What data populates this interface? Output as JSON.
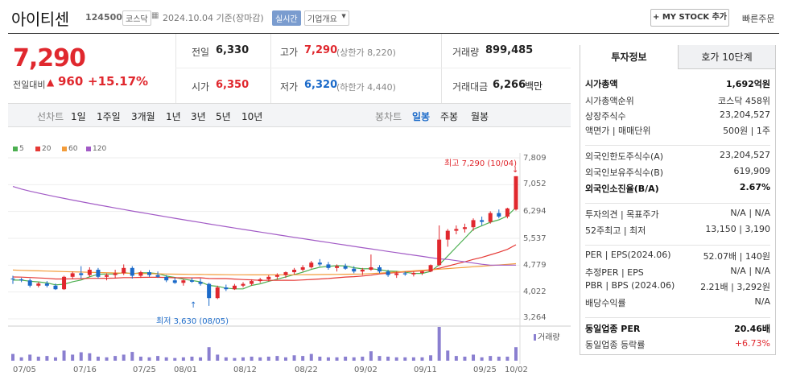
{
  "header": {
    "title": "아이티센",
    "code": "124500",
    "market_tag": "코스닥",
    "date_text": "2024.10.04 기준(장마감)",
    "live_tag": "실시간",
    "overview_tag": "기업개요",
    "mystock_label": "+ MY STOCK 추가",
    "quick_order": "빠른주문"
  },
  "quote": {
    "price": "7,290",
    "change_label": "전일대비",
    "change_value": "960",
    "change_pct": "+15.17%",
    "prev_label": "전일",
    "prev_value": "6,330",
    "high_label": "고가",
    "high_value": "7,290",
    "high_limit": "(상한가 8,220)",
    "volume_label": "거래량",
    "volume_value": "899,485",
    "open_label": "시가",
    "open_value": "6,350",
    "low_label": "저가",
    "low_value": "6,320",
    "low_limit": "(하한가 4,440)",
    "amount_label": "거래대금",
    "amount_value": "6,266",
    "amount_unit": "백만"
  },
  "periods": {
    "label": "선차트",
    "items": [
      "1일",
      "1주일",
      "3개월",
      "1년",
      "3년",
      "5년",
      "10년"
    ]
  },
  "candle_types": {
    "label": "봉차트",
    "items": [
      "일봉",
      "주봉",
      "월봉"
    ],
    "active": "일봉"
  },
  "chart_data": {
    "type": "candlestick",
    "legend": [
      {
        "name": "5",
        "color": "#4caf50"
      },
      {
        "name": "20",
        "color": "#e53935"
      },
      {
        "name": "60",
        "color": "#f39c3a"
      },
      {
        "name": "120",
        "color": "#a25bc6"
      }
    ],
    "yticks": [
      "7,809",
      "7,052",
      "6,294",
      "5,537",
      "4,779",
      "4,022",
      "3,264"
    ],
    "xticks": [
      "07/05",
      "07/16",
      "07/25",
      "08/01",
      "08/12",
      "08/22",
      "09/02",
      "09/11",
      "09/25",
      "10/02"
    ],
    "high_annotation": "최고 7,290 (10/04)",
    "low_annotation": "최저 3,630 (08/05)",
    "volume_label": "거래량",
    "candles": [
      [
        4400,
        4480,
        4250,
        4380
      ],
      [
        4380,
        4420,
        4300,
        4350
      ],
      [
        4350,
        4400,
        4150,
        4200
      ],
      [
        4200,
        4300,
        4150,
        4260
      ],
      [
        4260,
        4330,
        4150,
        4200
      ],
      [
        4200,
        4260,
        4080,
        4100
      ],
      [
        4100,
        4480,
        4080,
        4450
      ],
      [
        4450,
        4600,
        4380,
        4550
      ],
      [
        4550,
        4750,
        4400,
        4500
      ],
      [
        4500,
        4720,
        4450,
        4650
      ],
      [
        4650,
        4700,
        4400,
        4450
      ],
      [
        4450,
        4550,
        4350,
        4500
      ],
      [
        4500,
        4650,
        4400,
        4550
      ],
      [
        4550,
        4800,
        4500,
        4700
      ],
      [
        4700,
        4750,
        4400,
        4480
      ],
      [
        4480,
        4620,
        4420,
        4580
      ],
      [
        4580,
        4640,
        4450,
        4500
      ],
      [
        4500,
        4600,
        4420,
        4450
      ],
      [
        4450,
        4500,
        4300,
        4350
      ],
      [
        4350,
        4420,
        4250,
        4280
      ],
      [
        4280,
        4380,
        4200,
        4350
      ],
      [
        4350,
        4420,
        4280,
        4310
      ],
      [
        4310,
        4400,
        4200,
        4250
      ],
      [
        4250,
        4280,
        3630,
        3850
      ],
      [
        3850,
        4200,
        3820,
        4150
      ],
      [
        4150,
        4230,
        4050,
        4100
      ],
      [
        4100,
        4250,
        4080,
        4200
      ],
      [
        4200,
        4300,
        4150,
        4250
      ],
      [
        4250,
        4380,
        4200,
        4330
      ],
      [
        4330,
        4420,
        4280,
        4380
      ],
      [
        4380,
        4500,
        4320,
        4450
      ],
      [
        4450,
        4550,
        4380,
        4500
      ],
      [
        4500,
        4600,
        4420,
        4580
      ],
      [
        4580,
        4700,
        4520,
        4650
      ],
      [
        4650,
        4780,
        4600,
        4720
      ],
      [
        4720,
        4900,
        4680,
        4850
      ],
      [
        4850,
        4950,
        4750,
        4800
      ],
      [
        4800,
        4870,
        4650,
        4700
      ],
      [
        4700,
        4800,
        4600,
        4750
      ],
      [
        4750,
        4820,
        4650,
        4680
      ],
      [
        4680,
        4750,
        4550,
        4600
      ],
      [
        4600,
        4700,
        4500,
        4650
      ],
      [
        4650,
        5080,
        4620,
        4720
      ],
      [
        4720,
        4780,
        4550,
        4600
      ],
      [
        4600,
        4650,
        4450,
        4500
      ],
      [
        4500,
        4600,
        4420,
        4550
      ],
      [
        4550,
        4600,
        4480,
        4520
      ],
      [
        4520,
        4600,
        4460,
        4560
      ],
      [
        4560,
        4620,
        4500,
        4600
      ],
      [
        4600,
        4800,
        4580,
        4780
      ],
      [
        4780,
        5900,
        4750,
        5500
      ],
      [
        5500,
        5800,
        5300,
        5750
      ],
      [
        5750,
        5900,
        5650,
        5800
      ],
      [
        5800,
        5950,
        5700,
        5850
      ],
      [
        5850,
        6100,
        5750,
        6050
      ],
      [
        6050,
        6150,
        5900,
        6000
      ],
      [
        6000,
        6300,
        5950,
        6250
      ],
      [
        6250,
        6350,
        6100,
        6150
      ],
      [
        6150,
        6400,
        6100,
        6380
      ],
      [
        6350,
        7290,
        6320,
        7290
      ]
    ],
    "volumes": [
      20,
      10,
      18,
      12,
      14,
      10,
      30,
      18,
      25,
      22,
      12,
      10,
      14,
      18,
      26,
      12,
      10,
      14,
      10,
      8,
      10,
      12,
      10,
      40,
      18,
      10,
      8,
      10,
      12,
      10,
      12,
      14,
      10,
      16,
      14,
      20,
      12,
      10,
      10,
      12,
      10,
      12,
      28,
      14,
      12,
      10,
      10,
      10,
      10,
      16,
      100,
      30,
      14,
      12,
      18,
      10,
      14,
      12,
      12,
      40
    ]
  },
  "info": {
    "tabs": [
      "투자정보",
      "호가 10단계"
    ],
    "rows": [
      {
        "label": "시가총액",
        "value": "1,692억원",
        "bold": true
      },
      {
        "label": "시가총액순위",
        "value": "코스닥 458위"
      },
      {
        "label": "상장주식수",
        "value": "23,204,527"
      },
      {
        "label": "액면가 | 매매단위",
        "value": "500원 | 1주"
      },
      {
        "label": "외국인한도주식수(A)",
        "value": "23,204,527"
      },
      {
        "label": "외국인보유주식수(B)",
        "value": "619,909"
      },
      {
        "label": "외국인소진율(B/A)",
        "value": "2.67%",
        "bold": true
      },
      {
        "label": "투자의견 | 목표주가",
        "value": "N/A | N/A"
      },
      {
        "label": "52주최고 | 최저",
        "value": "13,150 | 3,190"
      },
      {
        "label": "PER | EPS(2024.06)",
        "value": "52.07배 | 140원"
      },
      {
        "label": "추정PER | EPS",
        "value": "N/A | N/A"
      },
      {
        "label": "PBR | BPS (2024.06)",
        "value": "2.21배 | 3,292원"
      },
      {
        "label": "배당수익률",
        "value": "N/A"
      },
      {
        "label": "동일업종 PER",
        "value": "20.46배",
        "bold": true
      },
      {
        "label": "동일업종 등락률",
        "value": "+6.73%",
        "red": true
      }
    ]
  },
  "colors": {
    "up": "#e0282e",
    "down": "#1b6ac9",
    "accent_tab": "#ffffff",
    "inactive_tab": "#f0f1f3"
  }
}
